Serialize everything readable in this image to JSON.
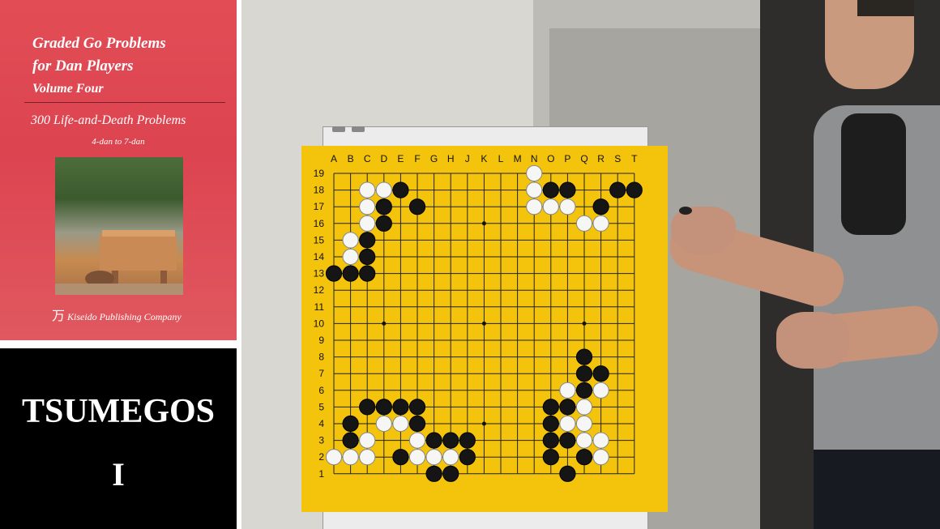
{
  "book": {
    "title_lines": [
      "Graded Go Problems",
      "for Dan Players",
      "Volume Four"
    ],
    "subtitle": "300 Life-and-Death Problems",
    "level": "4-dan to 7-dan",
    "publisher": "Kiseido Publishing Company"
  },
  "overlay": {
    "title": "TSUMEGOS",
    "number": "I"
  },
  "board": {
    "columns": [
      "A",
      "B",
      "C",
      "D",
      "E",
      "F",
      "G",
      "H",
      "J",
      "K",
      "L",
      "M",
      "N",
      "O",
      "P",
      "Q",
      "R",
      "S",
      "T"
    ],
    "rows": [
      "19",
      "18",
      "17",
      "16",
      "15",
      "14",
      "13",
      "12",
      "11",
      "10",
      "9",
      "8",
      "7",
      "6",
      "5",
      "4",
      "3",
      "2",
      "1"
    ],
    "color": "#f3c40b",
    "star_points": [
      "D16",
      "K16",
      "Q16",
      "D10",
      "K10",
      "Q10",
      "D4",
      "K4",
      "Q4"
    ],
    "black_stones": [
      "E18",
      "D17",
      "F17",
      "D16",
      "C15",
      "C14",
      "A13",
      "B13",
      "C13",
      "O18",
      "P18",
      "S18",
      "T18",
      "R17",
      "Q8",
      "Q7",
      "R7",
      "Q6",
      "O5",
      "P5",
      "O4",
      "O3",
      "P3",
      "O2",
      "Q2",
      "P1",
      "B4",
      "B3",
      "C5",
      "D5",
      "E5",
      "F5",
      "F4",
      "E2",
      "G3",
      "H3",
      "J3",
      "J2",
      "G1",
      "H1"
    ],
    "white_stones": [
      "C18",
      "D18",
      "C17",
      "C16",
      "B15",
      "B14",
      "N19",
      "N18",
      "N17",
      "O17",
      "P17",
      "Q16",
      "R16",
      "P6",
      "R6",
      "Q5",
      "P4",
      "Q4",
      "Q3",
      "R3",
      "R2",
      "D4",
      "E4",
      "C3",
      "A2",
      "B2",
      "C2",
      "F3",
      "F2",
      "G2",
      "H2"
    ]
  }
}
